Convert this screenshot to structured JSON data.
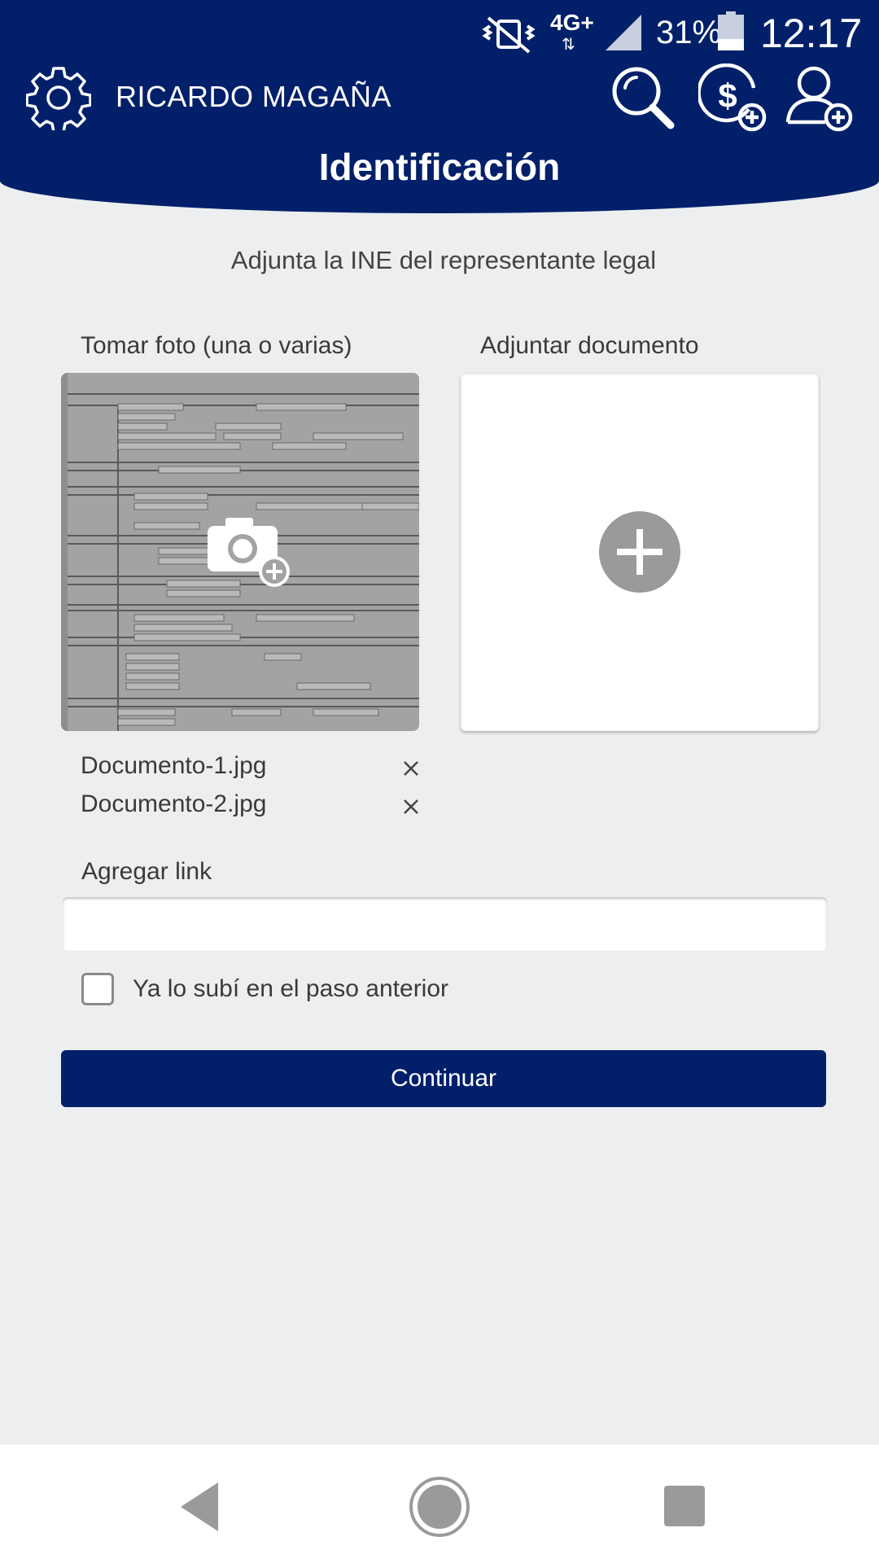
{
  "status_bar": {
    "network": "4G+",
    "network_arrows": "⇅",
    "battery": "31%",
    "battery_level": 0.31,
    "time": "12:17"
  },
  "header": {
    "user_name": "RICARDO MAGAÑA",
    "title": "Identificación"
  },
  "main": {
    "subtitle": "Adjunta la INE del representante legal",
    "photo_label": "Tomar foto (una o varias)",
    "document_label": "Adjuntar documento",
    "files": [
      {
        "name": "Documento-1.jpg"
      },
      {
        "name": "Documento-2.jpg"
      }
    ],
    "link_label": "Agregar link",
    "link_value": "",
    "link_placeholder": "",
    "checkbox_label": "Ya lo subí en el paso anterior",
    "checkbox_checked": false,
    "continue_label": "Continuar"
  },
  "icons": {
    "settings": "gear-icon",
    "search": "search-icon",
    "add_payment": "dollar-plus-icon",
    "add_user": "user-plus-icon",
    "camera": "camera-plus-icon",
    "add_document": "plus-circle-icon",
    "remove_file": "close-icon"
  },
  "colors": {
    "brand": "#02206a",
    "background": "#eceef0",
    "icon_grey": "#9a9a9a"
  }
}
